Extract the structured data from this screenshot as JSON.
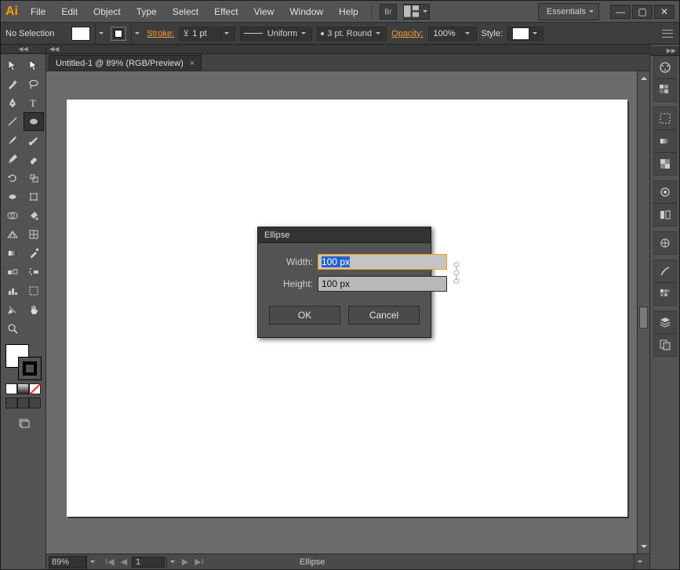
{
  "menubar": {
    "items": [
      "File",
      "Edit",
      "Object",
      "Type",
      "Select",
      "Effect",
      "View",
      "Window",
      "Help"
    ],
    "bridge_label": "Br",
    "workspace": "Essentials"
  },
  "window_controls": {
    "min": "—",
    "max": "▢",
    "close": "✕"
  },
  "control_bar": {
    "selection": "No Selection",
    "stroke_label": "Stroke:",
    "stroke_weight": "1 pt",
    "uniform": "Uniform",
    "cap": "3 pt. Round",
    "opacity_label": "Opacity:",
    "opacity": "100%",
    "style_label": "Style:"
  },
  "document": {
    "tab_title": "Untitled-1 @ 89% (RGB/Preview)"
  },
  "tools": {
    "left_col": [
      "selection",
      "magic-wand",
      "pen",
      "line-segment",
      "paintbrush",
      "pencil",
      "rotate",
      "width",
      "shape-builder",
      "perspective",
      "mesh",
      "eyedropper",
      "graph",
      "artboard",
      "hand"
    ],
    "right_col": [
      "direct-selection",
      "lasso",
      "type",
      "ellipse",
      "blob-brush",
      "eraser",
      "scale",
      "free-transform",
      "live-paint",
      "grid",
      "gradient",
      "blend",
      "symbol-sprayer",
      "slice",
      "zoom"
    ]
  },
  "right_dock": {
    "groups": [
      [
        "color",
        "swatches"
      ],
      [
        "stroke-panel",
        "gradient-panel",
        "transparency"
      ],
      [
        "appearance",
        "graphic-styles"
      ],
      [
        "layers"
      ],
      [
        "artboards"
      ]
    ]
  },
  "statusbar": {
    "zoom": "89%",
    "page": "1",
    "tool": "Ellipse"
  },
  "dialog": {
    "title": "Ellipse",
    "width_label": "Width:",
    "width_value": "100 px",
    "height_label": "Height:",
    "height_value": "100 px",
    "ok": "OK",
    "cancel": "Cancel"
  }
}
